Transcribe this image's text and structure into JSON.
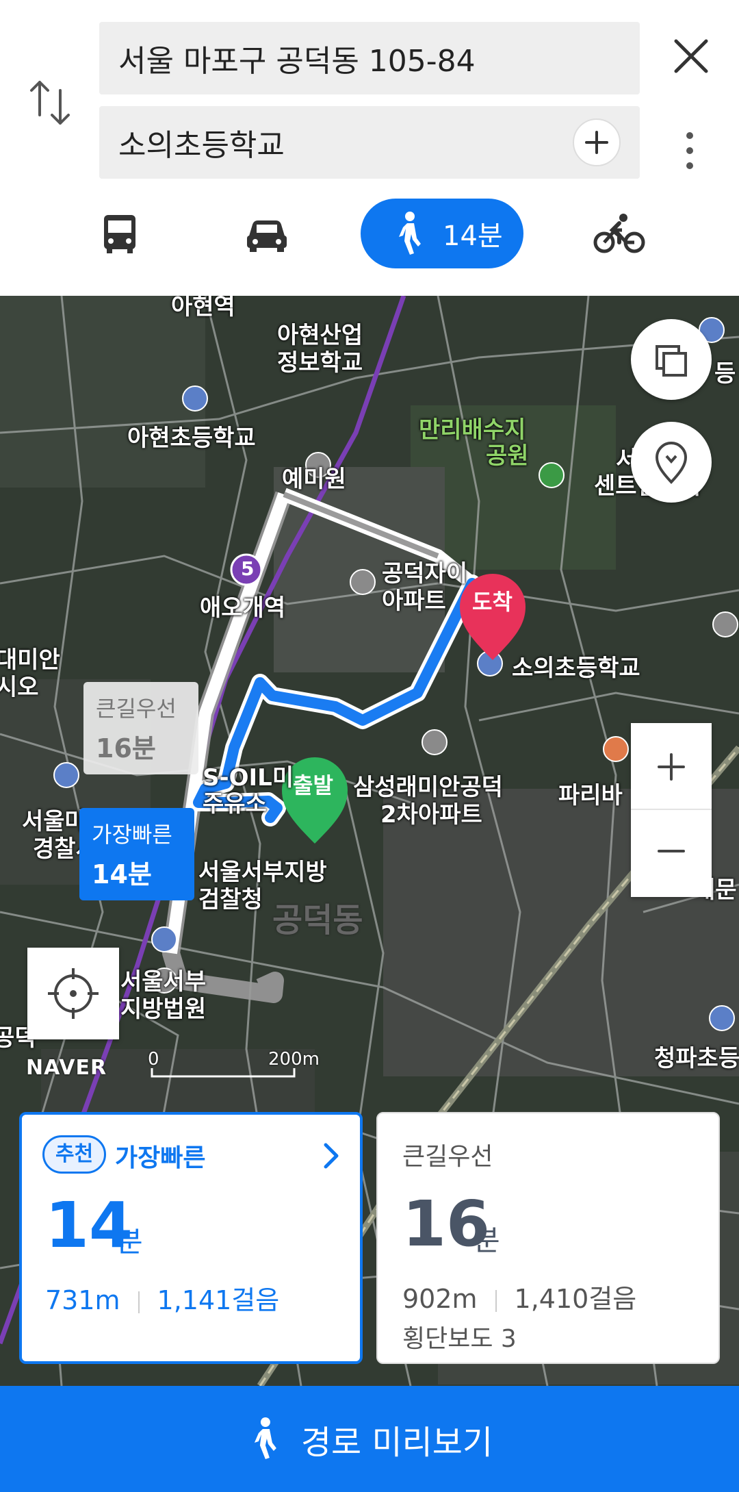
{
  "search": {
    "origin": "서울 마포구 공덕동 105-84",
    "destination": "소의초등학교"
  },
  "modes": {
    "walk_time": "14분",
    "selected": "walk"
  },
  "map": {
    "labels": {
      "l1": "아현역",
      "l2": "아현산업",
      "l3": "정보학교",
      "l4": "아현초등학교",
      "l5": "만리배수지",
      "l6": "공원",
      "l7": "서울",
      "l8": "센트럴자이",
      "l9": "예미원",
      "l10": "공덕자이",
      "l11": "아파트",
      "l12": "애오개역",
      "l13": "소의초등학교",
      "l14": "대미안",
      "l15": "시오",
      "l16": "삼성래미안공덕",
      "l17": "2차아파트",
      "l18": "파리바",
      "l19": "S-OIL미",
      "l20": "주유소",
      "l21": "서울마포",
      "l22": "경찰서",
      "l23": "서울서부지방",
      "l24": "검찰청",
      "l25": "공덕동",
      "l26": "서울서부",
      "l27": "지방법원",
      "l28": "청파초등",
      "l29": "등",
      "l30": "내문",
      "l31": "공덕"
    },
    "line_number": "5",
    "start_pin": "출발",
    "end_pin": "도착",
    "alt_tag": {
      "title": "큰길우선",
      "time": "16분"
    },
    "fast_tag": {
      "title": "가장빠른",
      "time": "14분"
    },
    "logo": "NAVER",
    "scale_min": "0",
    "scale_max": "200m"
  },
  "cards": [
    {
      "badge": "추천",
      "title": "가장빠른",
      "time": "14",
      "unit": "분",
      "distance": "731m",
      "steps": "1,141걸음"
    },
    {
      "title": "큰길우선",
      "time": "16",
      "unit": "분",
      "distance": "902m",
      "steps": "1,410걸음",
      "crosswalk": "횡단보도 3"
    }
  ],
  "preview_button": "경로 미리보기",
  "colors": {
    "accent": "#0e77f0",
    "start_pin": "#2db55d",
    "end_pin": "#e8325a",
    "subway_line": "#7a3fb4"
  }
}
